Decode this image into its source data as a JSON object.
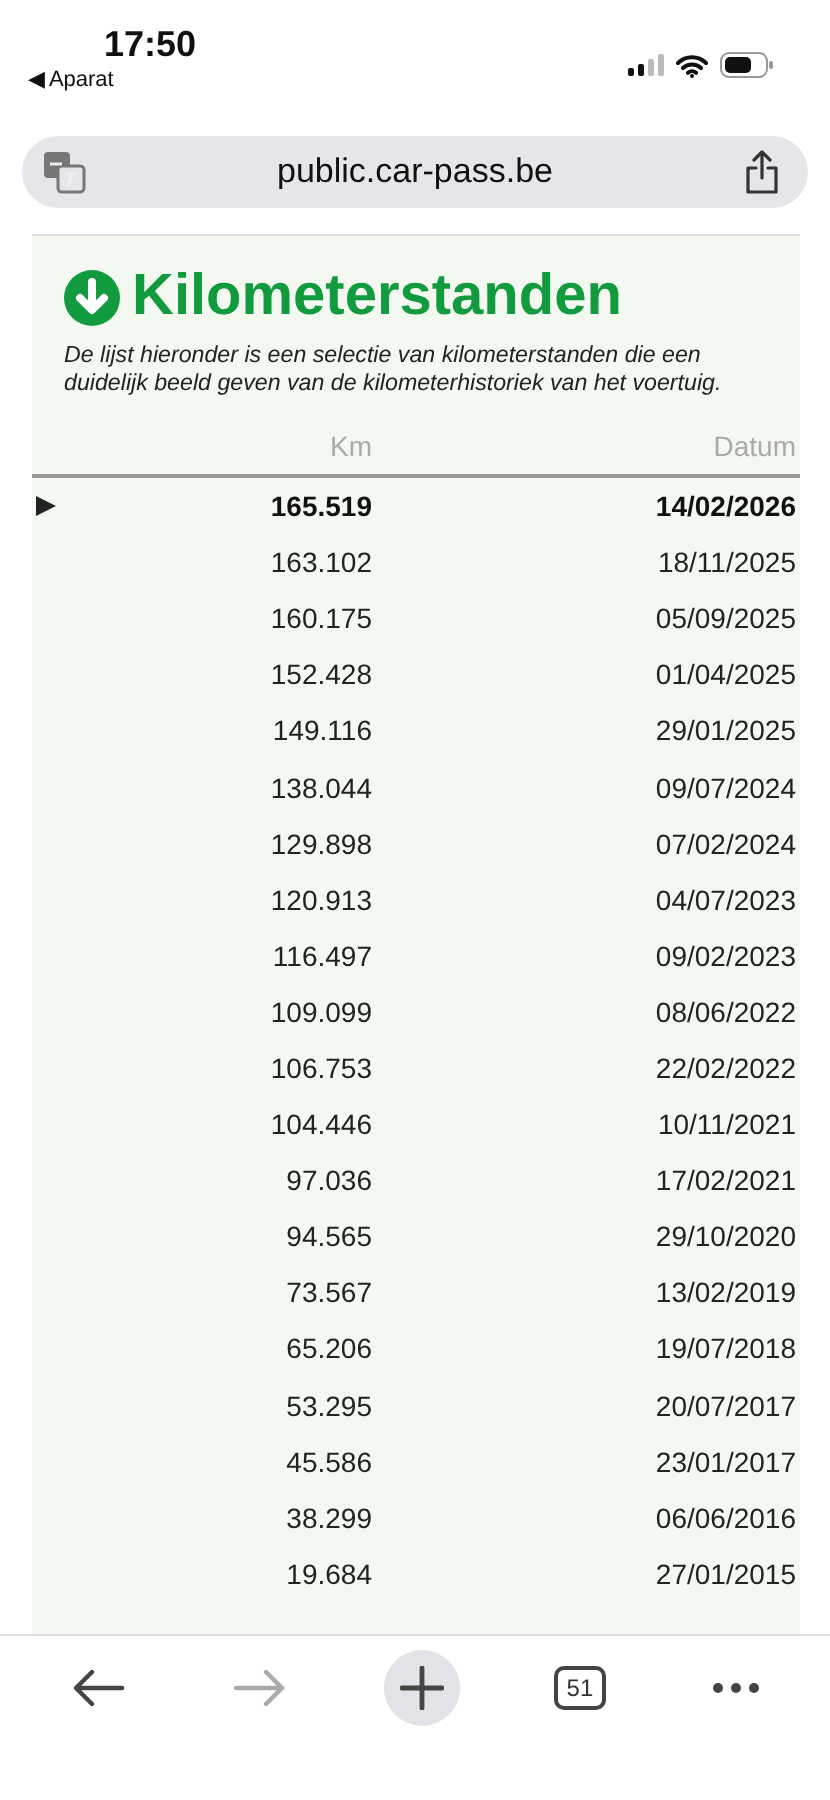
{
  "status_bar": {
    "time": "17:50",
    "back_app": "◀ Aparat"
  },
  "address_bar": {
    "url": "public.car-pass.be"
  },
  "section": {
    "title": "Kilometerstanden",
    "description": "De lijst hieronder is een selectie van kilometerstanden die een duidelijk beeld geven van de kilometerhistoriek van het voertuig."
  },
  "table": {
    "columns": [
      "Km",
      "Datum"
    ],
    "rows": [
      {
        "km": "165.519",
        "date": "14/02/2026",
        "selected": true
      },
      {
        "km": "163.102",
        "date": "18/11/2025",
        "selected": false
      },
      {
        "km": "160.175",
        "date": "05/09/2025",
        "selected": false
      },
      {
        "km": "152.428",
        "date": "01/04/2025",
        "selected": false
      },
      {
        "km": "149.116",
        "date": "29/01/2025",
        "selected": false
      },
      {
        "km": "138.044",
        "date": "09/07/2024",
        "selected": false
      },
      {
        "km": "129.898",
        "date": "07/02/2024",
        "selected": false
      },
      {
        "km": "120.913",
        "date": "04/07/2023",
        "selected": false
      },
      {
        "km": "116.497",
        "date": "09/02/2023",
        "selected": false
      },
      {
        "km": "109.099",
        "date": "08/06/2022",
        "selected": false
      },
      {
        "km": "106.753",
        "date": "22/02/2022",
        "selected": false
      },
      {
        "km": "104.446",
        "date": "10/11/2021",
        "selected": false
      },
      {
        "km": "97.036",
        "date": "17/02/2021",
        "selected": false
      },
      {
        "km": "94.565",
        "date": "29/10/2020",
        "selected": false
      },
      {
        "km": "73.567",
        "date": "13/02/2019",
        "selected": false
      },
      {
        "km": "65.206",
        "date": "19/07/2018",
        "selected": false
      },
      {
        "km": "53.295",
        "date": "20/07/2017",
        "selected": false
      },
      {
        "km": "45.586",
        "date": "23/01/2017",
        "selected": false
      },
      {
        "km": "38.299",
        "date": "06/06/2016",
        "selected": false
      },
      {
        "km": "19.684",
        "date": "27/01/2015",
        "selected": false
      }
    ]
  },
  "toolbar": {
    "items": [
      {
        "kind": "back",
        "disabled": false
      },
      {
        "kind": "forward",
        "disabled": true
      },
      {
        "kind": "new-tab"
      },
      {
        "kind": "tabs",
        "label": "51"
      },
      {
        "kind": "more"
      }
    ]
  }
}
